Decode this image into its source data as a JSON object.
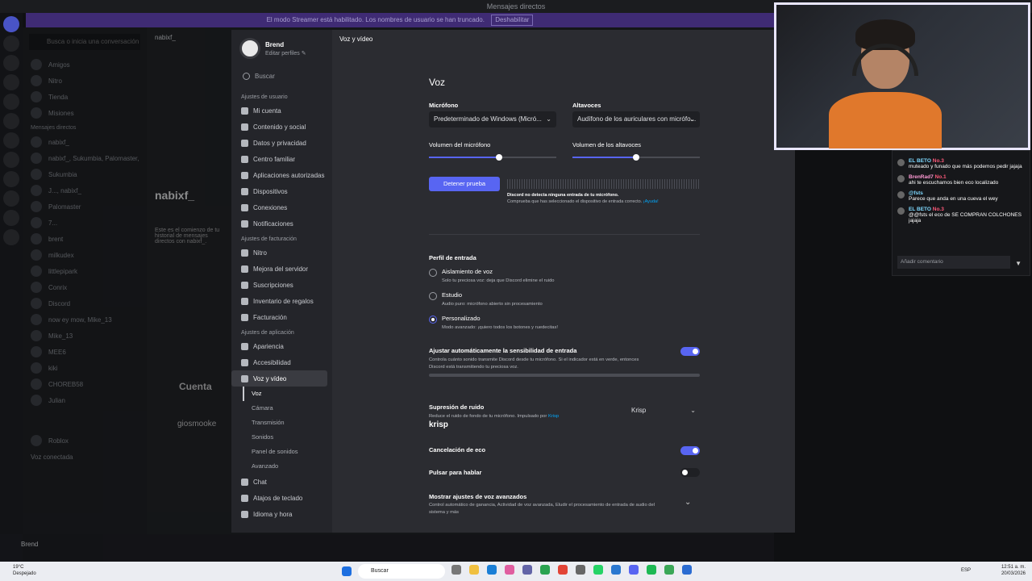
{
  "window": {
    "title": "Mensajes directos"
  },
  "banner": {
    "text": "El modo Streamer está habilitado. Los nombres de usuario se han truncado.",
    "button": "Deshabilitar"
  },
  "dm": {
    "search": "Busca o inicia una conversación",
    "nav": [
      "Amigos",
      "Nitro",
      "Tienda",
      "Misiones"
    ],
    "section": "Mensajes directos",
    "rows": [
      "nabixf_",
      "nabixf_, Sukumbia, Palomaster,",
      "Sukumbia",
      "J..., nabixf_",
      "Palomaster",
      "7...",
      "brent",
      "milkudex",
      "littlepipark",
      "Conrix",
      "Discord",
      "now ey mow, Mike_13",
      "Mike_13",
      "MEE6",
      "kiki",
      "CHOREB58",
      "Julian"
    ],
    "footer": "Roblox",
    "voice": "Voz conectada"
  },
  "chat_bg": {
    "user": "nabixf_",
    "name": "nabixf_",
    "hint": "Este es el comienzo de tu historial de mensajes directos con nabixf_.",
    "card": "Cuenta",
    "card2": "giosmooke"
  },
  "user": {
    "name": "Brend",
    "edit": "Editar perfiles ✎"
  },
  "sidebar": {
    "search": "Buscar",
    "groups": [
      {
        "header": "Ajustes de usuario",
        "items": [
          "Mi cuenta",
          "Contenido y social",
          "Datos y privacidad",
          "Centro familiar",
          "Aplicaciones autorizadas",
          "Dispositivos",
          "Conexiones",
          "Notificaciones"
        ]
      },
      {
        "header": "Ajustes de facturación",
        "items": [
          "Nitro",
          "Mejora del servidor",
          "Suscripciones",
          "Inventario de regalos",
          "Facturación"
        ]
      },
      {
        "header": "Ajustes de aplicación",
        "items": [
          "Apariencia",
          "Accesibilidad",
          "Voz y vídeo"
        ]
      }
    ],
    "subitems": [
      "Voz",
      "Cámara",
      "Transmisión",
      "Sonidos",
      "Panel de sonidos",
      "Avanzado"
    ],
    "after": [
      "Chat",
      "Atajos de teclado",
      "Idioma y hora"
    ]
  },
  "content": {
    "breadcrumb": "Voz y vídeo",
    "title": "Voz",
    "mic_label": "Micrófono",
    "mic_value": "Predeterminado de Windows (Micró...",
    "speaker_label": "Altavoces",
    "speaker_value": "Audífono de los auriculares con micrófo...",
    "mic_vol_label": "Volumen del micrófono",
    "mic_vol": 0.55,
    "speaker_vol_label": "Volumen de los altavoces",
    "speaker_vol": 0.5,
    "test_button": "Detener prueba",
    "no_input": "Discord no detecta ninguna entrada de tu micrófono.",
    "check_device": "Comprueba que has seleccionado el dispositivo de entrada correcto.",
    "help": "¡Ayuda!",
    "input_profile": "Perfil de entrada",
    "profiles": [
      {
        "title": "Aislamiento de voz",
        "desc": "Solo tu preciosa voz: deja que Discord elimine el ruido",
        "selected": false
      },
      {
        "title": "Estudio",
        "desc": "Audio puro: micrófono abierto sin procesamiento",
        "selected": false
      },
      {
        "title": "Personalizado",
        "desc": "Modo avanzado: ¡quiero todos los botones y ruedecitas!",
        "selected": true
      }
    ],
    "auto_sens_title": "Ajustar automáticamente la sensibilidad de entrada",
    "auto_sens_desc": "Controla cuánto sonido transmite Discord desde tu micrófono. Si el indicador está en verde, entonces Discord está transmitiendo tu preciosa voz.",
    "auto_sens_on": true,
    "noise_title": "Supresión de ruido",
    "noise_desc": "Reduce el ruido de fondo de tu micrófono. Impulsado por",
    "noise_link": "Krisp",
    "krisp_logo": "krisp",
    "noise_value": "Krisp",
    "echo_title": "Cancelación de eco",
    "echo_on": true,
    "ptt_title": "Pulsar para hablar",
    "ptt_on": false,
    "adv_title": "Mostrar ajustes de voz avanzados",
    "adv_desc": "Control automático de ganancia, Actividad de voz avanzada, Eludir el procesamiento de entrada de audio del sistema y más"
  },
  "stream_chat": {
    "messages": [
      {
        "user": "EL BETO",
        "badge": "No.3",
        "text": "muteado y funado que más podemos pedir jajaja"
      },
      {
        "user": "BrenRad7",
        "badge": "No.1",
        "text": "ahi te escuchamos bien eco localizado"
      },
      {
        "user": "@fsts",
        "badge": "",
        "text": "Parece que anda en una cueva el wey"
      },
      {
        "user": "EL BETO",
        "badge": "No.3",
        "text": "@@fsts el eco de SE COMPRAN COLCHONES jajaja"
      }
    ],
    "input": "Añadir comentario"
  },
  "taskbar": {
    "weather_temp": "19°C",
    "weather_desc": "Despejado",
    "search": "Buscar",
    "lang": "ESP",
    "time": "12:51 a. m.",
    "date": "20/03/2026"
  },
  "colors": {
    "accent": "#5865f2",
    "bg": "#2b2c31",
    "sidebar": "#24252a"
  }
}
